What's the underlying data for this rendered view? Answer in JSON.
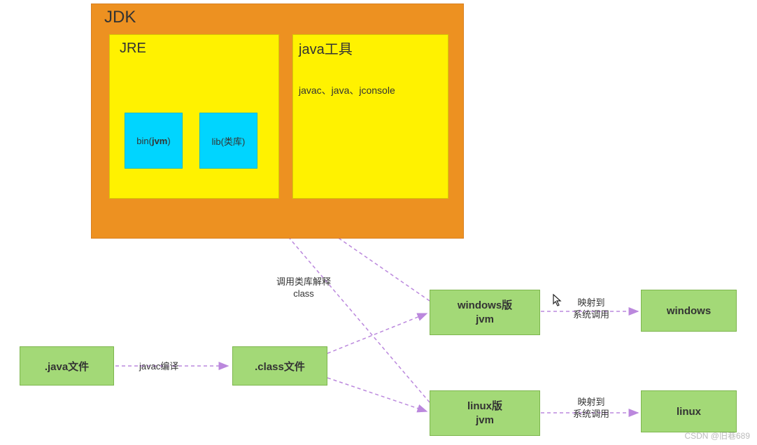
{
  "jdk": {
    "title": "JDK"
  },
  "jre": {
    "title": "JRE"
  },
  "bin": {
    "prefix": "bin(",
    "bold": "jvm",
    "suffix": ")"
  },
  "lib": {
    "label": "lib(类库)"
  },
  "tools": {
    "title": "java工具",
    "body": "javac、java、jconsole"
  },
  "boxes": {
    "java_file": ".java文件",
    "class_file": ".class文件",
    "windows_jvm_line1": "windows版",
    "windows_jvm_line2": "jvm",
    "linux_jvm_line1": "linux版",
    "linux_jvm_line2": "jvm",
    "windows_os": "windows",
    "linux_os": "linux"
  },
  "edges": {
    "javac": "javac编译",
    "interpret_line1": "调用类库解释",
    "interpret_line2": "class",
    "map_line1": "映射到",
    "map_line2": "系统调用"
  },
  "colors": {
    "orange": "#ed9121",
    "yellow": "#fff200",
    "cyan": "#00d5ff",
    "green": "#a3d977",
    "arrow": "#bb88dd"
  },
  "watermark": "CSDN @旧巷689"
}
